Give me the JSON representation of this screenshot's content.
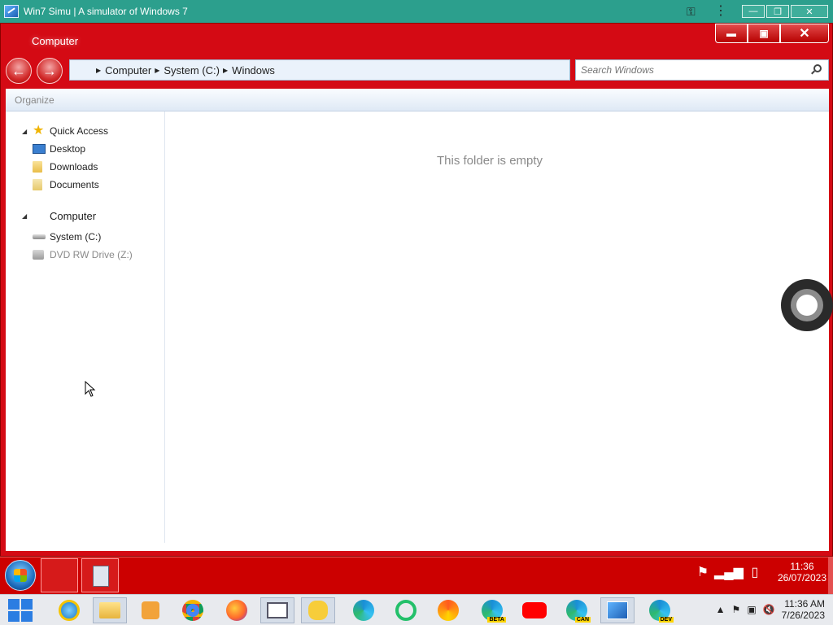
{
  "host": {
    "title": "Win7 Simu | A simulator of Windows 7",
    "key_icon": "key-icon",
    "menu_icon": "more-vertical-icon",
    "minimize_glyph": "—",
    "restore_glyph": "❐",
    "close_glyph": "✕"
  },
  "window": {
    "title": "Computer",
    "minimize_glyph": "▬",
    "maximize_glyph": "▣",
    "close_glyph": "✕",
    "back_glyph": "←",
    "forward_glyph": "→"
  },
  "address": {
    "crumbs": [
      "Computer",
      "System (C:)",
      "Windows"
    ]
  },
  "search": {
    "placeholder": "Search Windows"
  },
  "toolbar": {
    "organize_label": "Organize"
  },
  "navpane": {
    "quick_access_label": "Quick Access",
    "desktop_label": "Desktop",
    "downloads_label": "Downloads",
    "documents_label": "Documents",
    "computer_label": "Computer",
    "system_drive_label": "System (C:)",
    "dvd_drive_label": "DVD RW Drive (Z:)"
  },
  "main": {
    "empty_message": "This folder is empty"
  },
  "sim_taskbar": {
    "time": "11:36",
    "date": "26/07/2023"
  },
  "host_taskbar": {
    "time": "11:36 AM",
    "date": "7/26/2023",
    "badges": {
      "beta": "BETA",
      "can": "CAN",
      "dev": "DEV"
    }
  },
  "colors": {
    "window_red": "#d40a14",
    "host_bar": "#2c9f8d",
    "accent_blue": "#2b7de2"
  }
}
